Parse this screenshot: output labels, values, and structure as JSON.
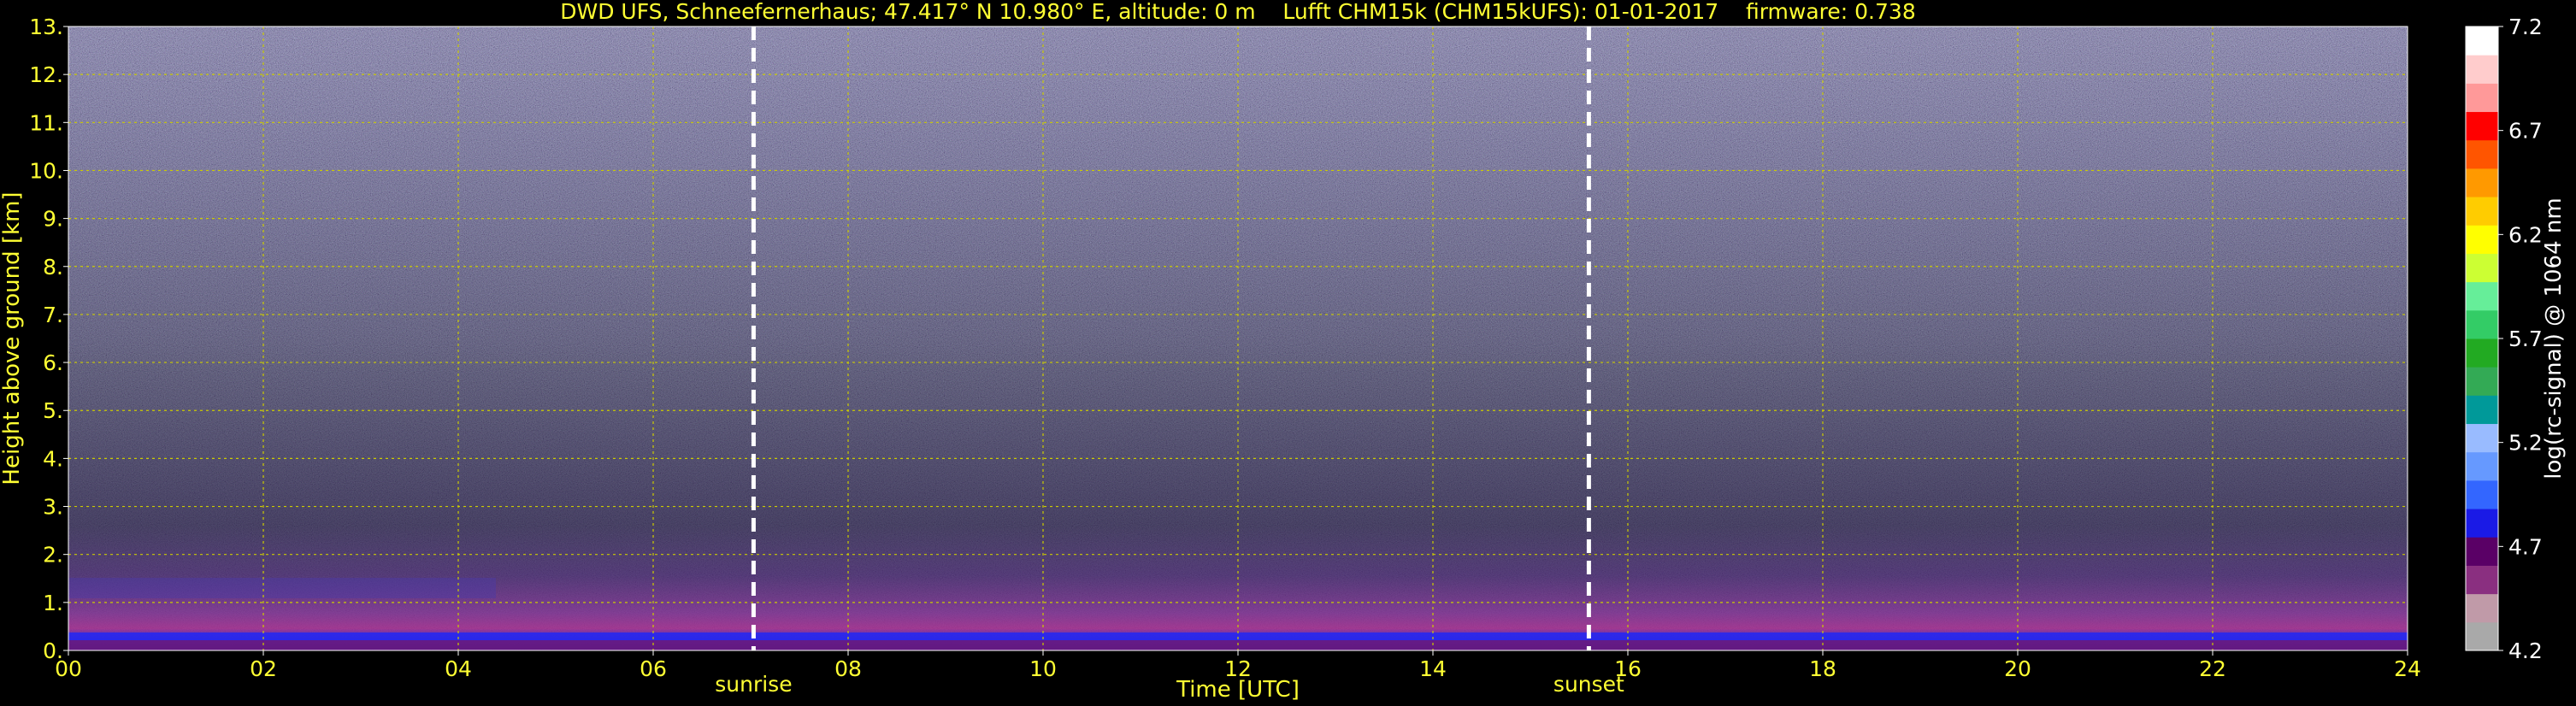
{
  "chart_data": {
    "type": "heatmap",
    "title": "DWD UFS, Schneefernerhaus; 47.417° N 10.980° E, altitude: 0 m    Lufft CHM15k (CHM15kUFS): 01-01-2017    firmware: 0.738",
    "xlabel": "Time [UTC]",
    "ylabel": "Height above ground [km]",
    "xlim": [
      0,
      24
    ],
    "ylim": [
      0,
      13
    ],
    "xticks": [
      "00",
      "02",
      "04",
      "06",
      "08",
      "10",
      "12",
      "14",
      "16",
      "18",
      "20",
      "22",
      "24"
    ],
    "yticks": [
      "0.",
      "1.",
      "2.",
      "3.",
      "4.",
      "5.",
      "6.",
      "7.",
      "8.",
      "9.",
      "10.",
      "11.",
      "12.",
      "13."
    ],
    "grid": true,
    "markers": [
      {
        "label": "sunrise",
        "x": 7.03
      },
      {
        "label": "sunset",
        "x": 15.6
      }
    ],
    "colorbar": {
      "label": "log(rc-signal) @ 1064 nm",
      "range": [
        4.2,
        7.2
      ],
      "ticks": [
        "4.2",
        "4.7",
        "5.2",
        "5.7",
        "6.2",
        "6.7",
        "7.2"
      ]
    }
  },
  "colors": {
    "text": "#ffff33",
    "grid": "#cccc00",
    "background": "#000000",
    "marker": "#ffffff",
    "colormap": [
      "#a9a9a9",
      "#c09aa8",
      "#8a2f80",
      "#5a0066",
      "#1a1ae6",
      "#3366ff",
      "#6699ff",
      "#99bbff",
      "#009999",
      "#33aa55",
      "#22aa22",
      "#33cc66",
      "#66ee99",
      "#ccff33",
      "#ffff00",
      "#ffcc00",
      "#ff9900",
      "#ff5500",
      "#ff0000",
      "#ff9999",
      "#ffcccc",
      "#ffffff"
    ]
  }
}
